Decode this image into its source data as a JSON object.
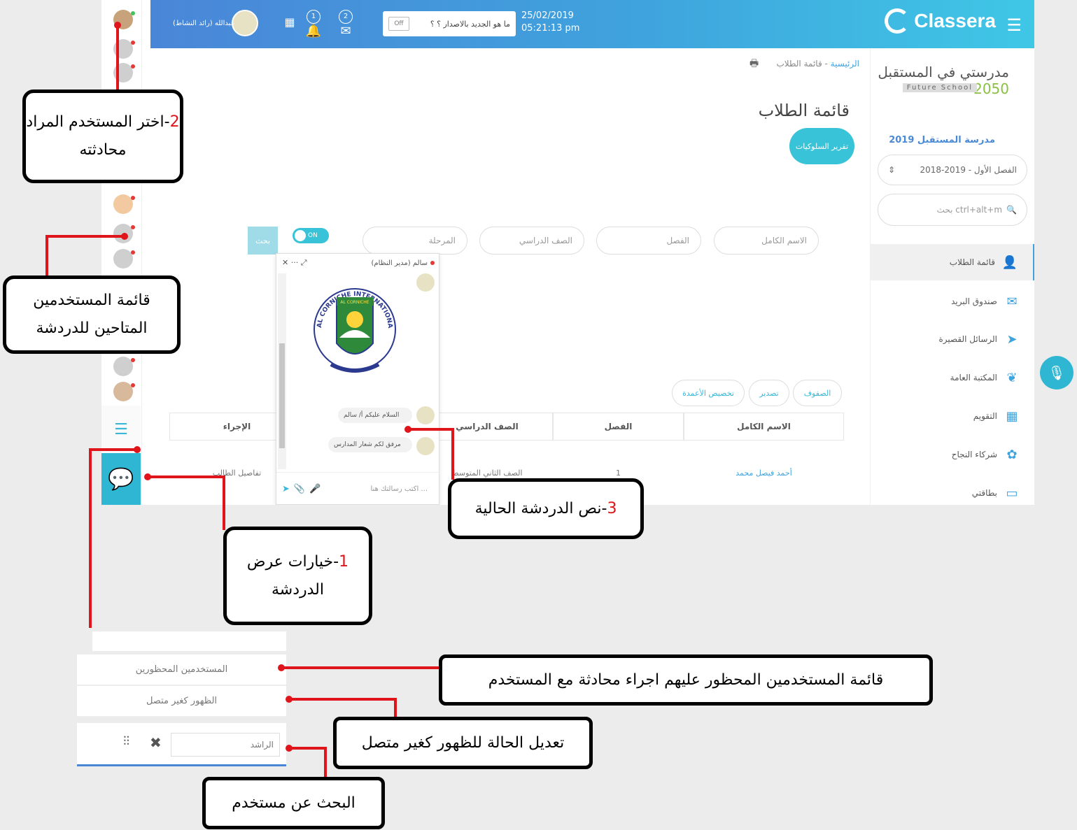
{
  "topbar": {
    "brand": "Classera",
    "date": "25/02/2019",
    "time": "05:21:13 pm",
    "whats_new": "ما هو الجديد بالاصدار ؟ ؟",
    "toggle_state": "Off",
    "notifications": [
      "1",
      "2"
    ],
    "user_name": "عبدالله (رائد النشاط)"
  },
  "school": {
    "logo_ar": "مدرستي في المستقبل",
    "logo_en": "Future School",
    "logo_year": "2050",
    "name": "مدرسة المستقبل 2019",
    "term": "الفصل الأول - 2019-2018",
    "search_placeholder": "بحث ctrl+alt+m"
  },
  "sidebar_menu": [
    {
      "label": "قائمة الطلاب",
      "icon": "user-icon",
      "active": true
    },
    {
      "label": "صندوق البريد",
      "icon": "mail-icon",
      "active": false
    },
    {
      "label": "الرسائل القصيرة",
      "icon": "send-icon",
      "active": false
    },
    {
      "label": "المكتبة العامة",
      "icon": "leaf-icon",
      "active": false
    },
    {
      "label": "التقويم",
      "icon": "calendar-icon",
      "active": false
    },
    {
      "label": "شركاء النجاح",
      "icon": "partners-icon",
      "active": false
    },
    {
      "label": "بطاقتي",
      "icon": "card-icon",
      "active": false
    }
  ],
  "breadcrumb": {
    "home": "الرئيسية",
    "separator": " - ",
    "current": "قائمة الطلاب"
  },
  "page_title": "قائمة الطلاب",
  "behavior_report_button": "تقرير السلوكيات",
  "filters": {
    "full_name": "الاسم الكامل",
    "section": "الفصل",
    "grade": "الصف الدراسي",
    "stage": "المرحلة",
    "toggle": "ON",
    "search": "بحث"
  },
  "table_actions": {
    "rows": "الصفوف",
    "export": "تصدير",
    "customize": "تخصيص الأعمدة"
  },
  "table": {
    "headers": [
      "الاسم الكامل",
      "الفصل",
      "الصف الدراسي",
      "الإجراء"
    ],
    "rows": [
      {
        "name": "أحمد فيصل محمد",
        "section": "1",
        "grade": "الصف الثاني المتوسط",
        "action": "تفاصيل الطالب"
      }
    ]
  },
  "chat_window": {
    "contact": "سالم (مدير النظام)",
    "seal_title": "AL CORNICHE INTERNATIONAL SCHOOL",
    "seal_badge": "AL CORNICHE",
    "messages": [
      "السلام عليكم أ/ سالم",
      "مرفق لكم شعار المدارس"
    ],
    "input_placeholder": "اكتب رسالتك هنا ..."
  },
  "popup_panel": {
    "blocked_users": "المستخدمين المحظورين",
    "appear_offline": "الظهور كغير متصل",
    "search_value": "الراشد"
  },
  "callouts": {
    "c2": {
      "num": "2",
      "text": "-اختر المستخدم المراد محادثته"
    },
    "list": {
      "text": "قائمة المستخدمين المتاحين للدردشة"
    },
    "c3": {
      "num": "3",
      "text": "-نص الدردشة الحالية"
    },
    "c1": {
      "num": "1",
      "text": "-خيارات عرض الدردشة"
    },
    "blocked": {
      "text": "قائمة المستخدمين المحظور عليهم اجراء محادثة مع المستخدم"
    },
    "offline": {
      "text": "تعديل الحالة للظهور كغير متصل"
    },
    "search": {
      "text": "البحث عن مستخدم"
    }
  },
  "colors": {
    "topbar_start": "#4a86d8",
    "topbar_end": "#3fc7e6",
    "accent": "#39c3d8",
    "callout_number": "#e0141b",
    "connector": "#e0141b"
  }
}
